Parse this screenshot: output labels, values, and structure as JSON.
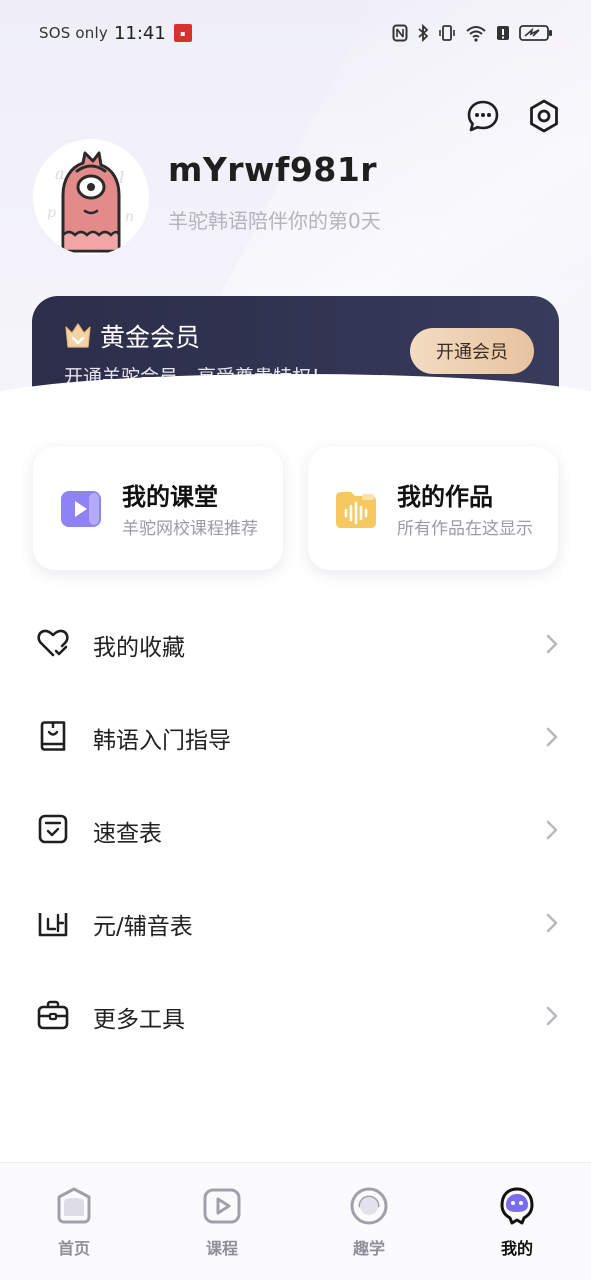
{
  "status_bar": {
    "network": "SOS only",
    "time": "11:41"
  },
  "profile": {
    "username": "mYrwf981r",
    "tagline": "羊驼韩语陪伴你的第0天"
  },
  "vip": {
    "title": "黄金会员",
    "description": "开通羊驼会员，享受尊贵特权！",
    "button": "开通会员"
  },
  "cards": [
    {
      "title": "我的课堂",
      "subtitle": "羊驼网校课程推荐",
      "icon": "play-video-icon",
      "color": "#7b6cf0"
    },
    {
      "title": "我的作品",
      "subtitle": "所有作品在这显示",
      "icon": "audio-folder-icon",
      "color": "#f4c14d"
    }
  ],
  "menu": [
    {
      "label": "我的收藏",
      "icon": "heart-check-icon"
    },
    {
      "label": "韩语入门指导",
      "icon": "book-icon"
    },
    {
      "label": "速查表",
      "icon": "checklist-icon"
    },
    {
      "label": "元/辅音表",
      "icon": "chart-icon"
    },
    {
      "label": "更多工具",
      "icon": "toolbox-icon"
    }
  ],
  "tabs": [
    {
      "label": "首页",
      "icon": "home-icon",
      "active": false
    },
    {
      "label": "课程",
      "icon": "course-play-icon",
      "active": false
    },
    {
      "label": "趣学",
      "icon": "fun-learn-icon",
      "active": false
    },
    {
      "label": "我的",
      "icon": "mine-icon",
      "active": true
    }
  ],
  "colors": {
    "vip_bg": "#2c2e4a",
    "vip_button": "#e6c39f",
    "accent_purple": "#7b6cf0",
    "accent_yellow": "#f4c14d",
    "muted_text": "#b4b4bd"
  }
}
